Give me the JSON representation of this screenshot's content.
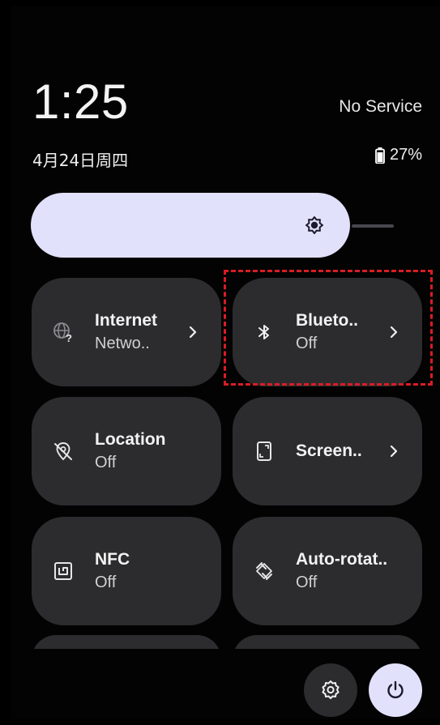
{
  "status": {
    "time": "1:25",
    "service": "No Service",
    "date": "4月24日周四",
    "battery": "27%"
  },
  "brightness": {
    "level": 0.88,
    "icon": "brightness-icon"
  },
  "tiles": [
    {
      "label": "Internet",
      "sub": "Netwo..",
      "icon": "globe-question-icon",
      "chevron": true
    },
    {
      "label": "Blueto..",
      "sub": "Off",
      "icon": "bluetooth-icon",
      "chevron": true
    },
    {
      "label": "Location",
      "sub": "Off",
      "icon": "location-off-icon",
      "chevron": false
    },
    {
      "label": "Screen..",
      "sub": "",
      "icon": "screen-record-icon",
      "chevron": true
    },
    {
      "label": "NFC",
      "sub": "Off",
      "icon": "nfc-icon",
      "chevron": false
    },
    {
      "label": "Auto-rotat..",
      "sub": "Off",
      "icon": "auto-rotate-icon",
      "chevron": false
    }
  ],
  "footer": {
    "settings_icon": "gear-icon",
    "power_icon": "power-icon"
  },
  "colors": {
    "tile": "#2c2c2f",
    "accent": "#e2e1fb",
    "highlight": "#d81d24"
  }
}
